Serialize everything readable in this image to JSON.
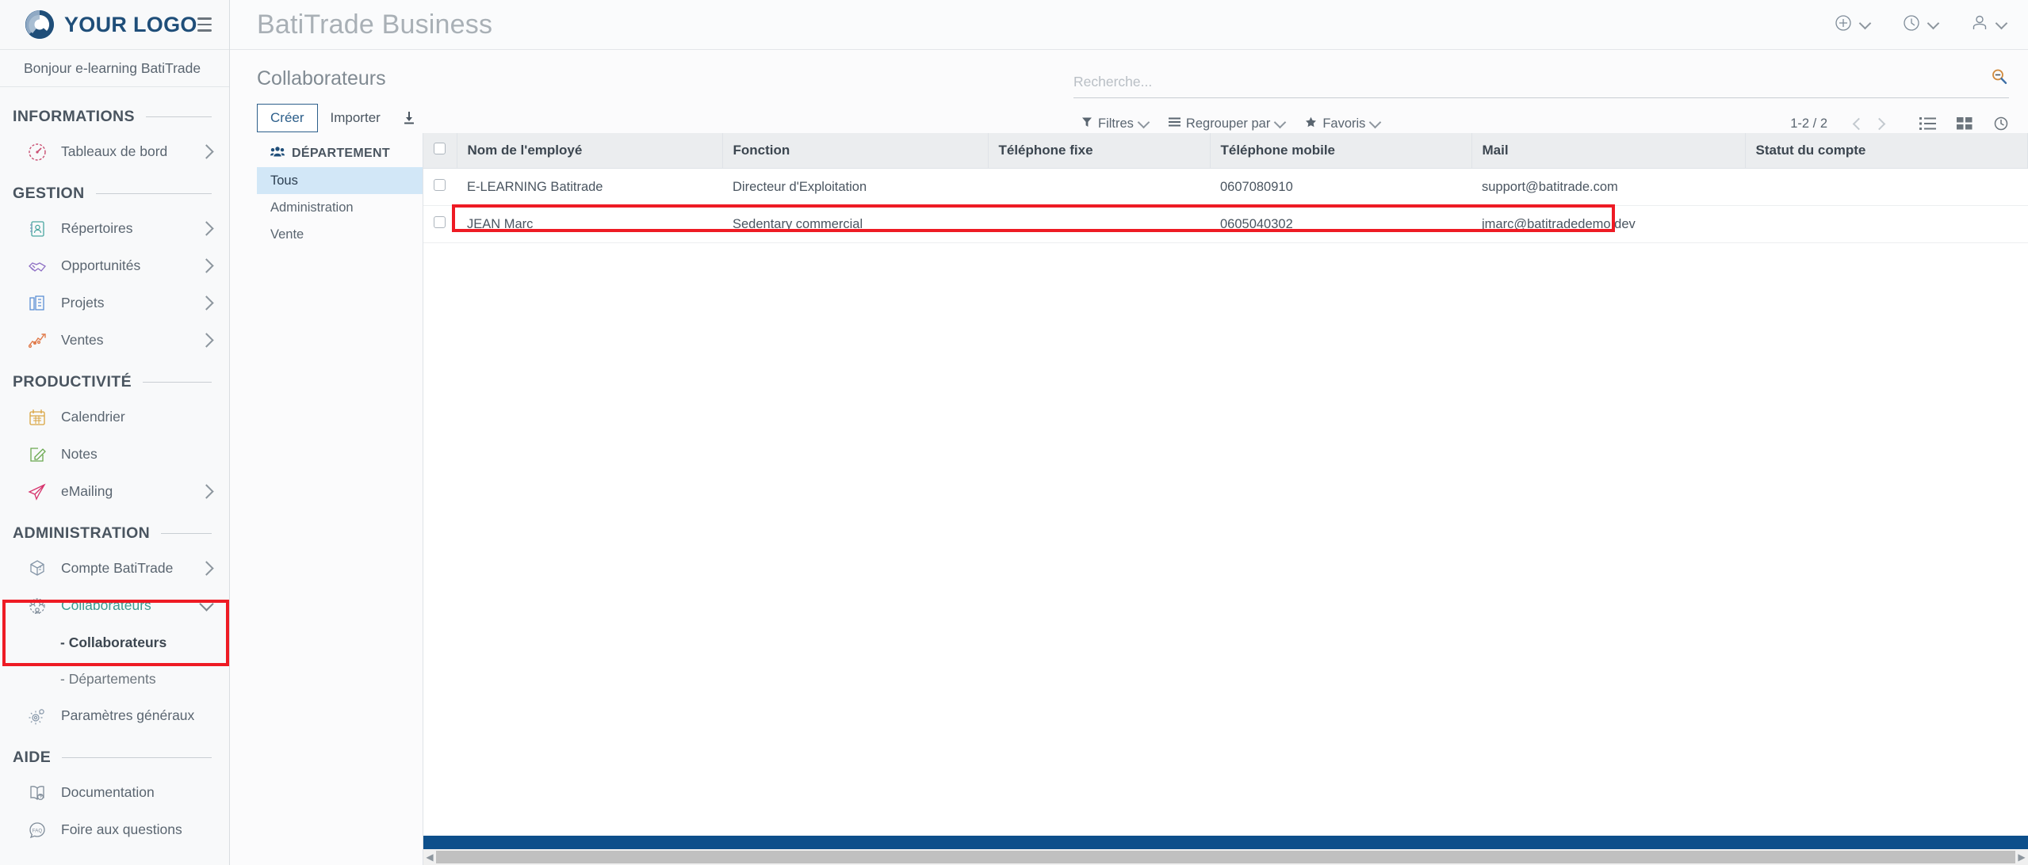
{
  "sidebar": {
    "logo_text": "YOUR LOGO",
    "greeting": "Bonjour e-learning BatiTrade",
    "groups": [
      {
        "label": "INFORMATIONS",
        "items": [
          {
            "label": "Tableaux de bord",
            "icon": "dashboard-gauge-icon",
            "has_chevron": true
          }
        ]
      },
      {
        "label": "GESTION",
        "items": [
          {
            "label": "Répertoires",
            "icon": "address-book-icon",
            "has_chevron": true
          },
          {
            "label": "Opportunités",
            "icon": "handshake-icon",
            "has_chevron": true
          },
          {
            "label": "Projets",
            "icon": "building-icon",
            "has_chevron": true
          },
          {
            "label": "Ventes",
            "icon": "trending-chart-icon",
            "has_chevron": true
          }
        ]
      },
      {
        "label": "PRODUCTIVITÉ",
        "items": [
          {
            "label": "Calendrier",
            "icon": "calendar-icon",
            "has_chevron": false
          },
          {
            "label": "Notes",
            "icon": "note-pencil-icon",
            "has_chevron": false
          },
          {
            "label": "eMailing",
            "icon": "paper-plane-icon",
            "has_chevron": true
          }
        ]
      },
      {
        "label": "ADMINISTRATION",
        "items": [
          {
            "label": "Compte BatiTrade",
            "icon": "cube-box-icon",
            "has_chevron": true
          },
          {
            "label": "Collaborateurs",
            "icon": "people-network-icon",
            "has_chevron": true,
            "active": true
          },
          {
            "label": "Paramètres généraux",
            "icon": "gears-icon",
            "has_chevron": false
          }
        ]
      },
      {
        "label": "AIDE",
        "items": [
          {
            "label": "Documentation",
            "icon": "open-book-icon",
            "has_chevron": false
          },
          {
            "label": "Foire aux questions",
            "icon": "faq-bubble-icon",
            "has_chevron": false
          }
        ]
      }
    ],
    "sub_items": [
      {
        "label": "- Collaborateurs",
        "current": true
      },
      {
        "label": "- Départements",
        "current": false
      }
    ]
  },
  "topbar": {
    "app_title": "BatiTrade Business",
    "actions": [
      {
        "icon": "plus-circle-icon",
        "name": "add-menu"
      },
      {
        "icon": "clock-icon",
        "name": "recent-menu"
      },
      {
        "icon": "user-icon",
        "name": "account-menu"
      }
    ]
  },
  "page": {
    "title": "Collaborateurs",
    "create_label": "Créer",
    "import_label": "Importer",
    "download_icon": "download-icon"
  },
  "search": {
    "placeholder": "Recherche...",
    "value": "",
    "icon": "search-icon"
  },
  "filters": [
    {
      "label": "Filtres",
      "icon": "funnel-icon"
    },
    {
      "label": "Regrouper par",
      "icon": "list-lines-icon"
    },
    {
      "label": "Favoris",
      "icon": "star-icon"
    }
  ],
  "pagination": {
    "range": "1-2 / 2",
    "prev_icon": "chevron-left-icon",
    "next_icon": "chevron-right-icon"
  },
  "view_modes": [
    {
      "icon": "list-view-icon",
      "active": true
    },
    {
      "icon": "grid-view-icon",
      "active": false
    },
    {
      "icon": "clock-view-icon",
      "active": false
    }
  ],
  "department_panel": {
    "header": "DÉPARTEMENT",
    "header_icon": "people-group-icon",
    "items": [
      {
        "label": "Tous",
        "selected": true
      },
      {
        "label": "Administration",
        "selected": false
      },
      {
        "label": "Vente",
        "selected": false
      }
    ]
  },
  "table": {
    "columns": [
      "Nom de l'employé",
      "Fonction",
      "Téléphone fixe",
      "Téléphone mobile",
      "Mail",
      "Statut du compte"
    ],
    "rows": [
      {
        "name": "E-LEARNING Batitrade",
        "fonction": "Directeur d'Exploitation",
        "tel_fixe": "",
        "tel_mobile": "0607080910",
        "mail": "support@batitrade.com",
        "statut": "",
        "highlighted": false
      },
      {
        "name": "JEAN Marc",
        "fonction": "Sedentary commercial",
        "tel_fixe": "",
        "tel_mobile": "0605040302",
        "mail": "jmarc@batitradedemo.dev",
        "statut": "",
        "highlighted": true
      }
    ]
  },
  "colors": {
    "highlight_red": "#ee1b24",
    "brand_blue": "#1f4e79",
    "accent_teal": "#3b9b8f",
    "selected_blue": "#d2e7f7",
    "bar_blue": "#0d4f8b"
  }
}
